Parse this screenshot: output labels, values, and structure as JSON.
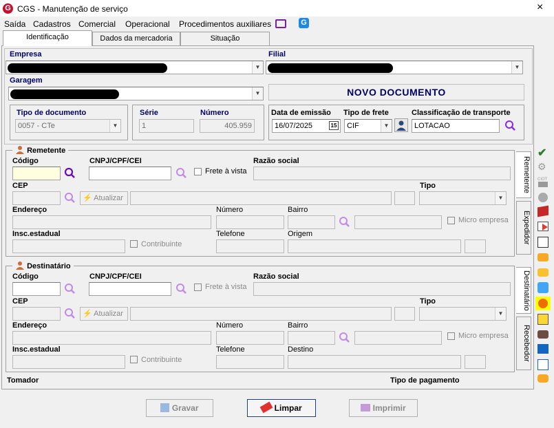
{
  "window": {
    "title": "CGS - Manutenção de serviço",
    "close": "×"
  },
  "menu": [
    {
      "label": "Saída"
    },
    {
      "label": "Cadastros"
    },
    {
      "label": "Comercial"
    },
    {
      "label": "Operacional"
    },
    {
      "label": "Procedimentos auxiliares"
    }
  ],
  "tabs": [
    {
      "label": "Identificação",
      "active": true
    },
    {
      "label": "Dados da mercadoria"
    },
    {
      "label": "Situação"
    }
  ],
  "header": {
    "empresa_label": "Empresa",
    "filial_label": "Filial",
    "garagem_label": "Garagem",
    "status_banner": "NOVO DOCUMENTO",
    "tipo_documento_label": "Tipo de documento",
    "tipo_documento_value": "0057 - CTe",
    "serie_label": "Série",
    "serie_value": "1",
    "numero_label": "Número",
    "numero_value": "405.959",
    "data_emissao_label": "Data de emissão",
    "data_emissao_value": "16/07/2025",
    "calendar_text": "15",
    "tipo_frete_label": "Tipo de frete",
    "tipo_frete_value": "CIF",
    "classificacao_label": "Classificação de transporte",
    "classificacao_value": "LOTACAO"
  },
  "remetente": {
    "title": "Remetente",
    "codigo": "Código",
    "cnpj": "CNPJ/CPF/CEI",
    "frete_vista": "Frete à vista",
    "razao": "Razão social",
    "cep": "CEP",
    "atualizar": "Atualizar",
    "tipo": "Tipo",
    "endereco": "Endereço",
    "numero": "Número",
    "bairro": "Bairro",
    "micro": "Micro empresa",
    "insc": "Insc.estadual",
    "contribuinte": "Contribuinte",
    "telefone": "Telefone",
    "origem": "Origem"
  },
  "destinatario": {
    "title": "Destinatário",
    "codigo": "Código",
    "cnpj": "CNPJ/CPF/CEI",
    "frete_vista": "Frete à vista",
    "razao": "Razão social",
    "cep": "CEP",
    "atualizar": "Atualizar",
    "tipo": "Tipo",
    "endereco": "Endereço",
    "numero": "Número",
    "bairro": "Bairro",
    "micro": "Micro empresa",
    "insc": "Insc.estadual",
    "contribuinte": "Contribuinte",
    "telefone": "Telefone",
    "destino": "Destino"
  },
  "side_tabs": {
    "remetente": "Remetente",
    "expedidor": "Expedidor",
    "destinatario": "Destinatário",
    "recebedor": "Recebedor"
  },
  "footer": {
    "tomador": "Tomador",
    "tipo_pagamento": "Tipo de pagamento"
  },
  "buttons": {
    "gravar": "Gravar",
    "limpar": "Limpar",
    "imprimir": "Imprimir"
  },
  "toolbar_icons": [
    "check-icon",
    "gear-icon",
    "ciot-label",
    "square-icon",
    "circle-icon",
    "truck-icon",
    "arrow-doc-icon",
    "copy-icon",
    "hand-point-icon",
    "hand-point-icon-2",
    "people-icon",
    "highlight-person-icon",
    "doc-list-icon",
    "hand-money-icon",
    "book-icon",
    "docs-icon",
    "handshake-icon"
  ],
  "toolbar_ciot": "CIOT",
  "colors": {
    "accent": "#000066",
    "brand": "#c8102e",
    "magnifier": "#8a2be2",
    "highlight": "#ffff00"
  }
}
